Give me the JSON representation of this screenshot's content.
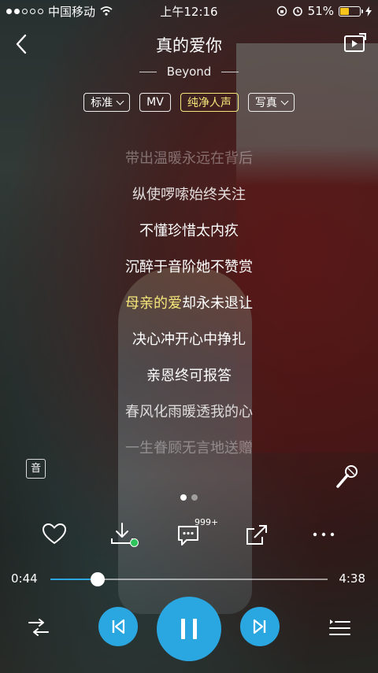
{
  "status_bar": {
    "carrier": "中国移动",
    "time": "上午12:16",
    "battery_text": "51%",
    "battery_level": 0.51,
    "signal_dots_filled": 2,
    "signal_dots_total": 5
  },
  "header": {
    "song_title": "真的爱你",
    "artist": "Beyond"
  },
  "mode_chips": [
    {
      "label": "标准",
      "has_dropdown": true,
      "active": false
    },
    {
      "label": "MV",
      "has_dropdown": false,
      "active": false
    },
    {
      "label": "纯净人声",
      "has_dropdown": false,
      "active": true
    },
    {
      "label": "写真",
      "has_dropdown": true,
      "active": false
    }
  ],
  "lyrics": {
    "line0": "带出温暖永远在背后",
    "line1": "纵使啰嗦始终关注",
    "line2": "不懂珍惜太内疚",
    "line3": "沉醉于音阶她不赞赏",
    "current_sung": "母亲的爱",
    "current_rest": "却永未退让",
    "line5": "决心冲开心中挣扎",
    "line6": "亲恩终可报答",
    "line7": "春风化雨暖透我的心",
    "line8": "一生眷顾无言地送赠"
  },
  "sound_effect_label": "音",
  "comment_count": "999+",
  "progress": {
    "current": "0:44",
    "total": "4:38",
    "fraction": 0.17
  },
  "colors": {
    "accent": "#2aa6e0",
    "highlight": "#f6e77a",
    "downloaded": "#2fc35b",
    "battery": "#f7c51c"
  },
  "icons": {
    "back": "back-chevron-icon",
    "cast": "cast-play-icon",
    "mic": "microphone-icon",
    "favorite": "heart-icon",
    "download": "download-icon",
    "comment": "comment-icon",
    "share": "share-icon",
    "more": "more-icon",
    "shuffle": "shuffle-icon",
    "prev": "previous-icon",
    "pause": "pause-icon",
    "next": "next-icon",
    "playlist": "playlist-icon"
  }
}
